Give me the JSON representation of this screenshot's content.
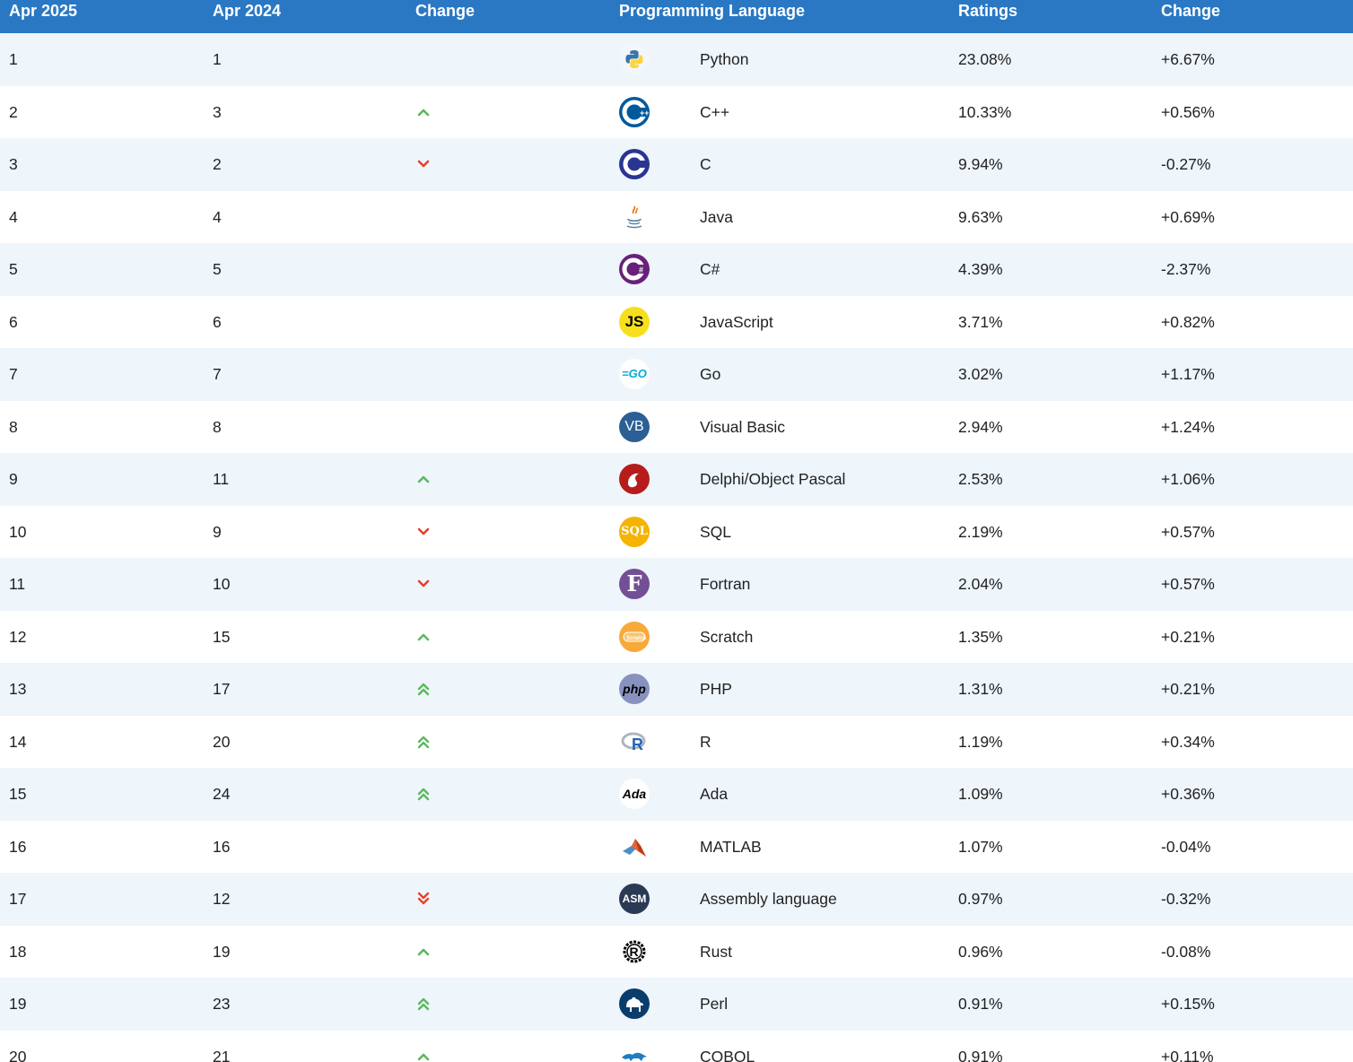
{
  "header": {
    "col_current": "Apr 2025",
    "col_previous": "Apr 2024",
    "col_change": "Change",
    "col_language": "Programming Language",
    "col_ratings": "Ratings",
    "col_delta": "Change"
  },
  "colors": {
    "header_bg": "#2a78c4",
    "row_alt_bg": "#eef5fb",
    "up_arrow": "#5cb85c",
    "down_arrow": "#e8412b"
  },
  "rows": [
    {
      "rank": "1",
      "prev": "1",
      "trend": "none",
      "icon": "python-icon",
      "name": "Python",
      "rating": "23.08%",
      "delta": "+6.67%"
    },
    {
      "rank": "2",
      "prev": "3",
      "trend": "up",
      "icon": "cpp-icon",
      "name": "C++",
      "rating": "10.33%",
      "delta": "+0.56%"
    },
    {
      "rank": "3",
      "prev": "2",
      "trend": "down",
      "icon": "c-icon",
      "name": "C",
      "rating": "9.94%",
      "delta": "-0.27%"
    },
    {
      "rank": "4",
      "prev": "4",
      "trend": "none",
      "icon": "java-icon",
      "name": "Java",
      "rating": "9.63%",
      "delta": "+0.69%"
    },
    {
      "rank": "5",
      "prev": "5",
      "trend": "none",
      "icon": "csharp-icon",
      "name": "C#",
      "rating": "4.39%",
      "delta": "-2.37%"
    },
    {
      "rank": "6",
      "prev": "6",
      "trend": "none",
      "icon": "javascript-icon",
      "name": "JavaScript",
      "rating": "3.71%",
      "delta": "+0.82%"
    },
    {
      "rank": "7",
      "prev": "7",
      "trend": "none",
      "icon": "go-icon",
      "name": "Go",
      "rating": "3.02%",
      "delta": "+1.17%"
    },
    {
      "rank": "8",
      "prev": "8",
      "trend": "none",
      "icon": "visual-basic-icon",
      "name": "Visual Basic",
      "rating": "2.94%",
      "delta": "+1.24%"
    },
    {
      "rank": "9",
      "prev": "11",
      "trend": "up",
      "icon": "delphi-icon",
      "name": "Delphi/Object Pascal",
      "rating": "2.53%",
      "delta": "+1.06%"
    },
    {
      "rank": "10",
      "prev": "9",
      "trend": "down",
      "icon": "sql-icon",
      "name": "SQL",
      "rating": "2.19%",
      "delta": "+0.57%"
    },
    {
      "rank": "11",
      "prev": "10",
      "trend": "down",
      "icon": "fortran-icon",
      "name": "Fortran",
      "rating": "2.04%",
      "delta": "+0.57%"
    },
    {
      "rank": "12",
      "prev": "15",
      "trend": "up",
      "icon": "scratch-icon",
      "name": "Scratch",
      "rating": "1.35%",
      "delta": "+0.21%"
    },
    {
      "rank": "13",
      "prev": "17",
      "trend": "double-up",
      "icon": "php-icon",
      "name": "PHP",
      "rating": "1.31%",
      "delta": "+0.21%"
    },
    {
      "rank": "14",
      "prev": "20",
      "trend": "double-up",
      "icon": "r-icon",
      "name": "R",
      "rating": "1.19%",
      "delta": "+0.34%"
    },
    {
      "rank": "15",
      "prev": "24",
      "trend": "double-up",
      "icon": "ada-icon",
      "name": "Ada",
      "rating": "1.09%",
      "delta": "+0.36%"
    },
    {
      "rank": "16",
      "prev": "16",
      "trend": "none",
      "icon": "matlab-icon",
      "name": "MATLAB",
      "rating": "1.07%",
      "delta": "-0.04%"
    },
    {
      "rank": "17",
      "prev": "12",
      "trend": "double-down",
      "icon": "assembly-icon",
      "name": "Assembly language",
      "rating": "0.97%",
      "delta": "-0.32%"
    },
    {
      "rank": "18",
      "prev": "19",
      "trend": "up",
      "icon": "rust-icon",
      "name": "Rust",
      "rating": "0.96%",
      "delta": "-0.08%"
    },
    {
      "rank": "19",
      "prev": "23",
      "trend": "double-up",
      "icon": "perl-icon",
      "name": "Perl",
      "rating": "0.91%",
      "delta": "+0.15%"
    },
    {
      "rank": "20",
      "prev": "21",
      "trend": "up",
      "icon": "cobol-icon",
      "name": "COBOL",
      "rating": "0.91%",
      "delta": "+0.11%"
    }
  ]
}
